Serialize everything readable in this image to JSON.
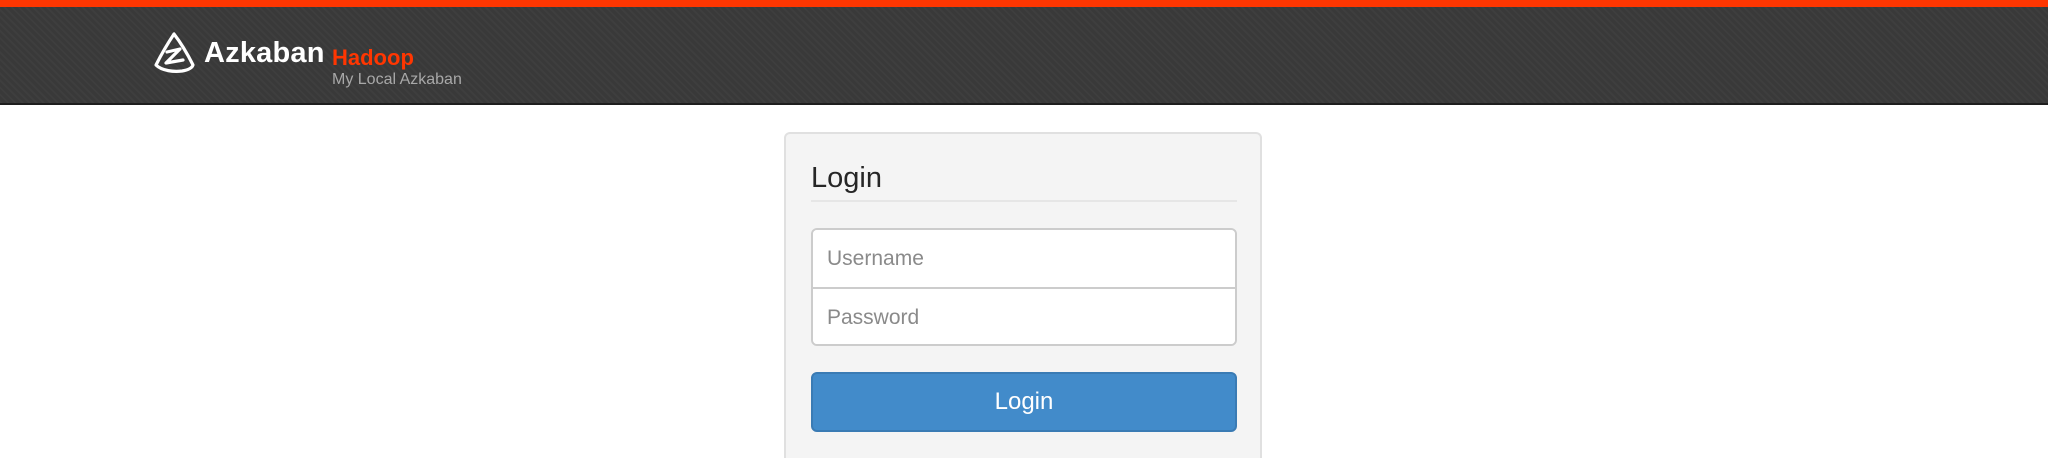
{
  "header": {
    "brand_name": "Azkaban",
    "environment": "Hadoop",
    "subtitle": "My Local Azkaban",
    "logo_icon": "azkaban-logo-icon",
    "accent_color": "#ff3601",
    "background_color": "#393939"
  },
  "login": {
    "title": "Login",
    "username_placeholder": "Username",
    "username_value": "",
    "password_placeholder": "Password",
    "password_value": "",
    "submit_label": "Login",
    "button_color": "#428bca"
  }
}
